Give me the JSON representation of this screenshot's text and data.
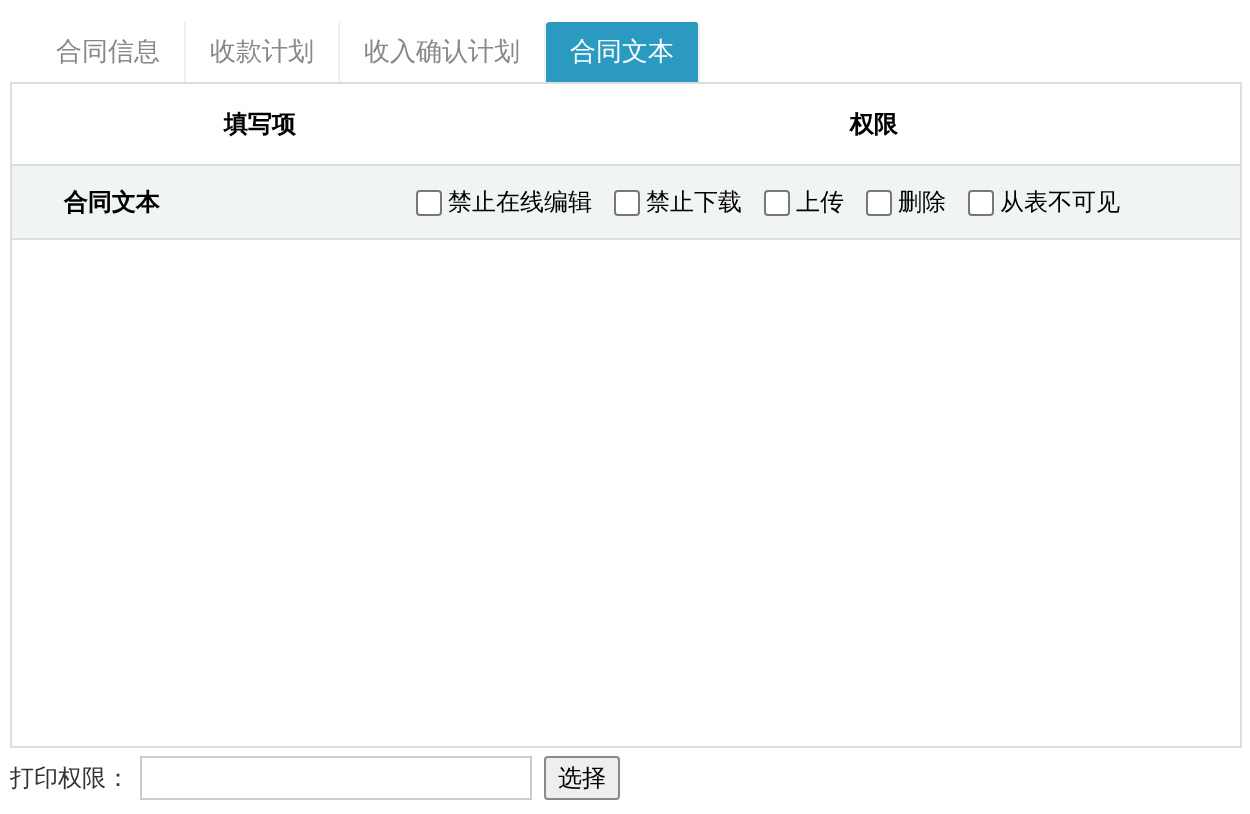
{
  "tabs": [
    {
      "label": "合同信息",
      "selected": false
    },
    {
      "label": "收款计划",
      "selected": false
    },
    {
      "label": "收入确认计划",
      "selected": false
    },
    {
      "label": "合同文本",
      "selected": true
    }
  ],
  "table": {
    "columns": [
      "填写项",
      "权限"
    ],
    "rows": [
      {
        "field": "合同文本",
        "permissions": [
          {
            "label": "禁止在线编辑",
            "checked": false
          },
          {
            "label": "禁止下载",
            "checked": false
          },
          {
            "label": "上传",
            "checked": false
          },
          {
            "label": "删除",
            "checked": false
          },
          {
            "label": "从表不可见",
            "checked": false
          }
        ]
      }
    ]
  },
  "print_permission": {
    "label": "打印权限：",
    "button": "选择"
  }
}
